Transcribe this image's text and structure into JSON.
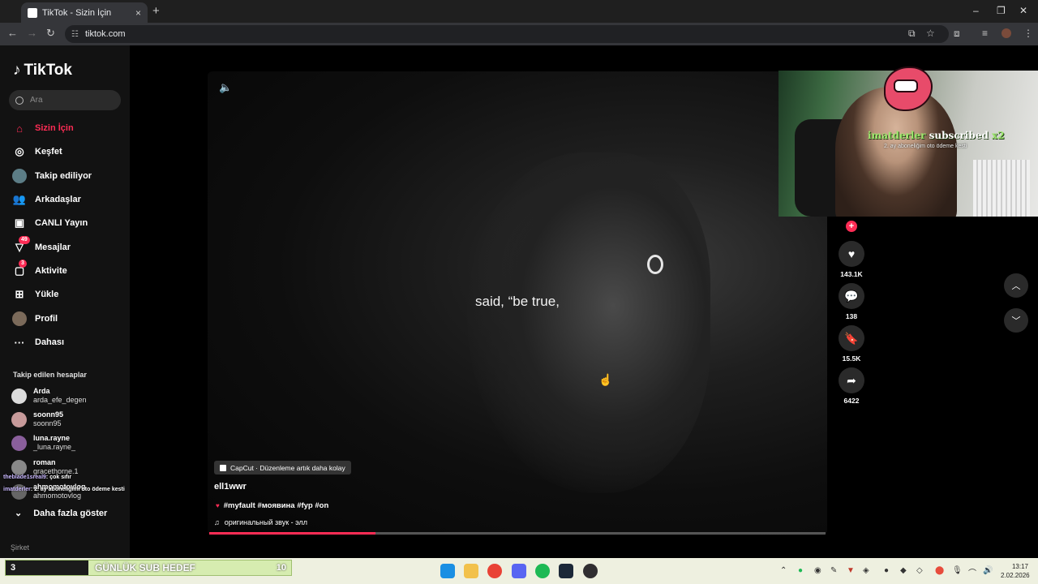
{
  "browser": {
    "tab_title": "TikTok - Sizin İçin",
    "tab_close": "×",
    "new_tab": "+",
    "url": "tiktok.com",
    "window_controls": [
      "–",
      "❐",
      "✕"
    ]
  },
  "sidebar": {
    "logo": "TikTok",
    "search_placeholder": "Ara",
    "nav": [
      {
        "label": "Sizin İçin",
        "icon": "home-icon",
        "active": true
      },
      {
        "label": "Keşfet",
        "icon": "compass-icon"
      },
      {
        "label": "Takip ediliyor",
        "icon": "following-avatar-icon"
      },
      {
        "label": "Arkadaşlar",
        "icon": "friends-icon"
      },
      {
        "label": "CANLI Yayın",
        "icon": "live-icon"
      },
      {
        "label": "Mesajlar",
        "icon": "messages-icon",
        "badge": "49"
      },
      {
        "label": "Aktivite",
        "icon": "activity-icon",
        "badge": "3"
      },
      {
        "label": "Yükle",
        "icon": "upload-icon"
      },
      {
        "label": "Profil",
        "icon": "profile-avatar-icon"
      },
      {
        "label": "Dahası",
        "icon": "more-dots-icon"
      }
    ],
    "following_title": "Takip edilen hesaplar",
    "following": [
      {
        "name": "Arda",
        "handle": "arda_efe_degen"
      },
      {
        "name": "soonn95",
        "handle": "soonn95"
      },
      {
        "name": "luna.rayne",
        "handle": "_luna.rayne_"
      },
      {
        "name": "roman",
        "handle": "gracethorne.1"
      },
      {
        "name": "ahmomotovlog",
        "handle": "ahmomotovlog"
      }
    ],
    "show_more": "Daha fazla göster",
    "company": "Şirket"
  },
  "video": {
    "caption": "said, “be true,",
    "capcut": "CapCut · Düzenleme artık daha kolay",
    "author": "ell1wwr",
    "tags": "#myfault #моявина #fyp #on",
    "sound": "оригинальный звук - элл",
    "progress": 0.27
  },
  "actions": {
    "likes": "143.1K",
    "comments": "138",
    "saves": "15.5K",
    "shares": "6422"
  },
  "stream": {
    "alert_user": "imatderler",
    "alert_text": "subscribed",
    "alert_mult": "x2",
    "alert_note": "2. ay aboneliğim oto ödeme kesti",
    "chat": [
      {
        "user": "theblade1sreal9",
        "text": ": çok sıfır"
      },
      {
        "user": "imatderler",
        "text": ": 2. ay aboneliğimi oto ödeme kesti"
      }
    ],
    "goal_current": "3",
    "goal_label": "GÜNLÜK SUB HEDEF",
    "goal_target": "10"
  },
  "taskbar": {
    "time": "13:17",
    "date": "2.02.2026"
  }
}
